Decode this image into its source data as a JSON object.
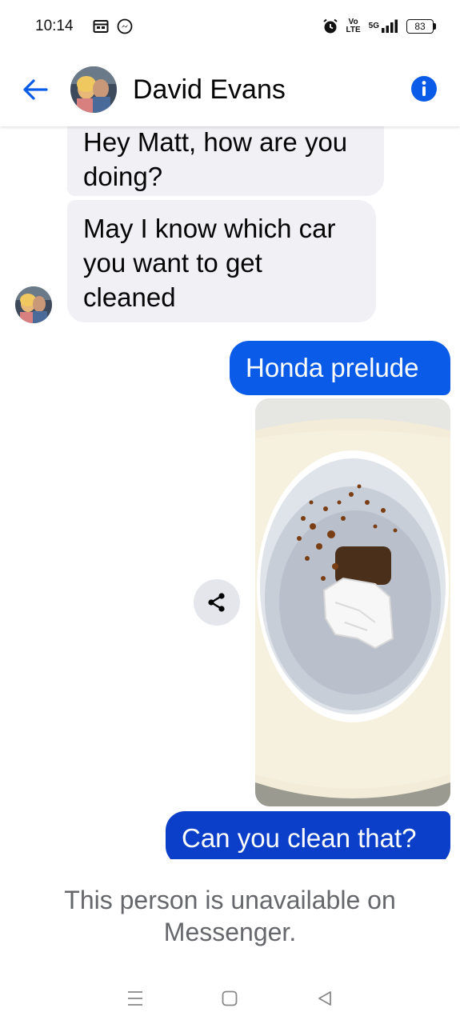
{
  "status_bar": {
    "time": "10:14",
    "network_top": "Vo",
    "network_bottom": "LTE",
    "signal_label": "5G",
    "battery": "83",
    "icons": [
      "calendar-icon",
      "messenger-icon",
      "alarm-icon",
      "signal-icon"
    ]
  },
  "header": {
    "contact_name": "David Evans",
    "back_icon": "arrow-left-icon",
    "info_icon": "info-icon",
    "accent_color": "#0a5ce8"
  },
  "messages": [
    {
      "direction": "incoming",
      "text": "Hey Matt, how are you doing?"
    },
    {
      "direction": "incoming",
      "text": "May I know which car you want to get cleaned"
    },
    {
      "direction": "outgoing",
      "text": "Honda prelude"
    },
    {
      "direction": "outgoing",
      "type": "photo"
    },
    {
      "direction": "outgoing",
      "text": "Can you clean that?"
    }
  ],
  "share_icon": "share-icon",
  "notice": {
    "text": "This person is unavailable on Messenger."
  },
  "nav": {
    "icons": [
      "menu-icon",
      "home-square-icon",
      "back-triangle-icon"
    ]
  },
  "colors": {
    "incoming_bubble": "#f0f0f5",
    "outgoing_bubble": "#0a5ce8",
    "outgoing_bubble_dark": "#0b3fc9",
    "notice_text": "#65676b"
  }
}
